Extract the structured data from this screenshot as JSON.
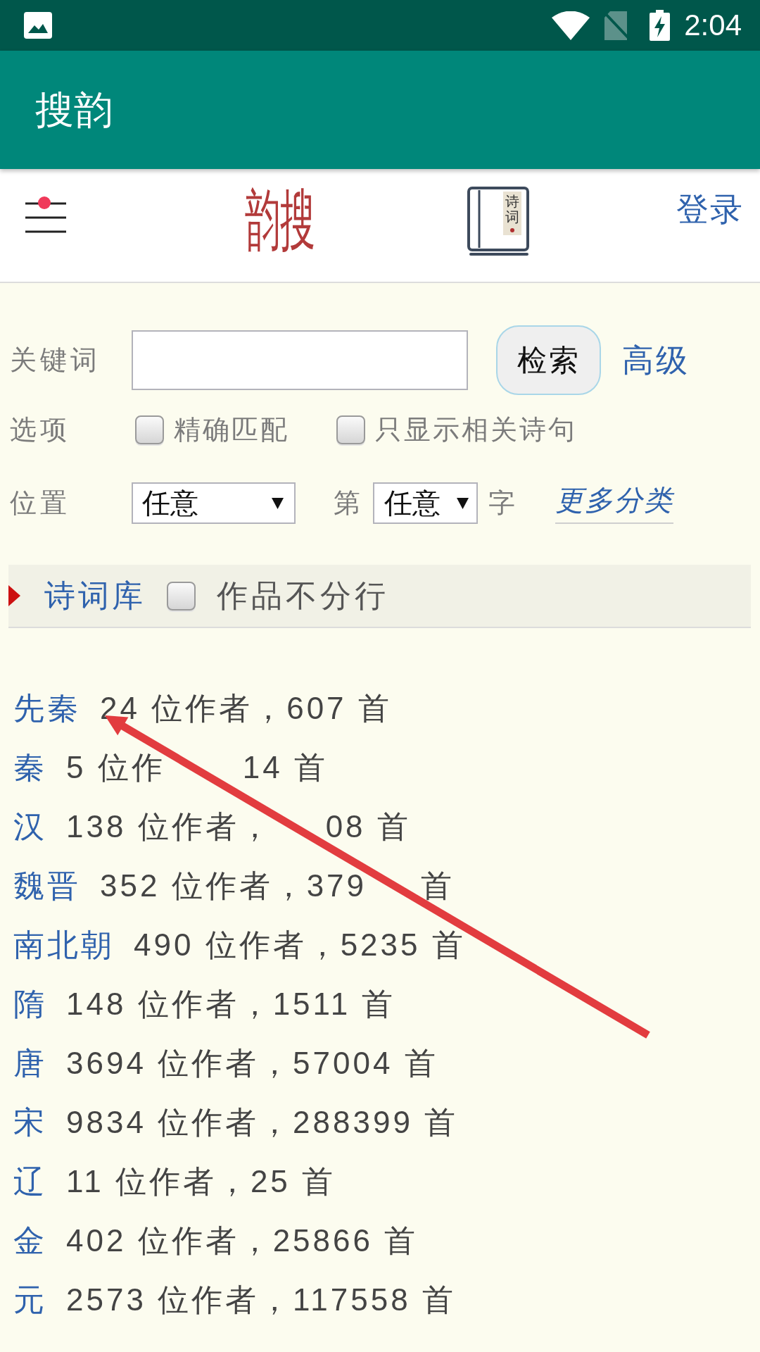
{
  "status_bar": {
    "time": "2:04"
  },
  "app_bar": {
    "title": "搜韵"
  },
  "header": {
    "logo": "韵搜",
    "book_label": "诗词",
    "login": "登录"
  },
  "search_form": {
    "keyword_label": "关键词",
    "search_button": "检索",
    "advanced_link": "高级",
    "options_label": "选项",
    "options": [
      {
        "label": "精确匹配",
        "checked": false
      },
      {
        "label": "只显示相关诗句",
        "checked": false
      }
    ],
    "position_label": "位置",
    "position_select": "任意",
    "char_prefix": "第",
    "char_select": "任意",
    "char_suffix": "字",
    "more_link": "更多分类"
  },
  "library": {
    "title": "诗词库",
    "no_line_break": {
      "label": "作品不分行",
      "checked": false
    }
  },
  "dynasties": [
    {
      "name": "先秦",
      "stats": [
        "24 位作者，607 首"
      ]
    },
    {
      "name": "秦",
      "stats": [
        "5 位作",
        "14 首"
      ]
    },
    {
      "name": "汉",
      "stats": [
        "138 位作者，",
        "08 首"
      ]
    },
    {
      "name": "魏晋",
      "stats": [
        "352 位作者，379",
        "首"
      ]
    },
    {
      "name": "南北朝",
      "stats": [
        "490 位作者，5235 首"
      ]
    },
    {
      "name": "隋",
      "stats": [
        "148 位作者，1511 首"
      ]
    },
    {
      "name": "唐",
      "stats": [
        "3694 位作者，57004 首"
      ]
    },
    {
      "name": "宋",
      "stats": [
        "9834 位作者，288399 首"
      ]
    },
    {
      "name": "辽",
      "stats": [
        "11 位作者，25 首"
      ]
    },
    {
      "name": "金",
      "stats": [
        "402 位作者，25866 首"
      ]
    },
    {
      "name": "元",
      "stats": [
        "2573 位作者，117558 首"
      ]
    }
  ]
}
